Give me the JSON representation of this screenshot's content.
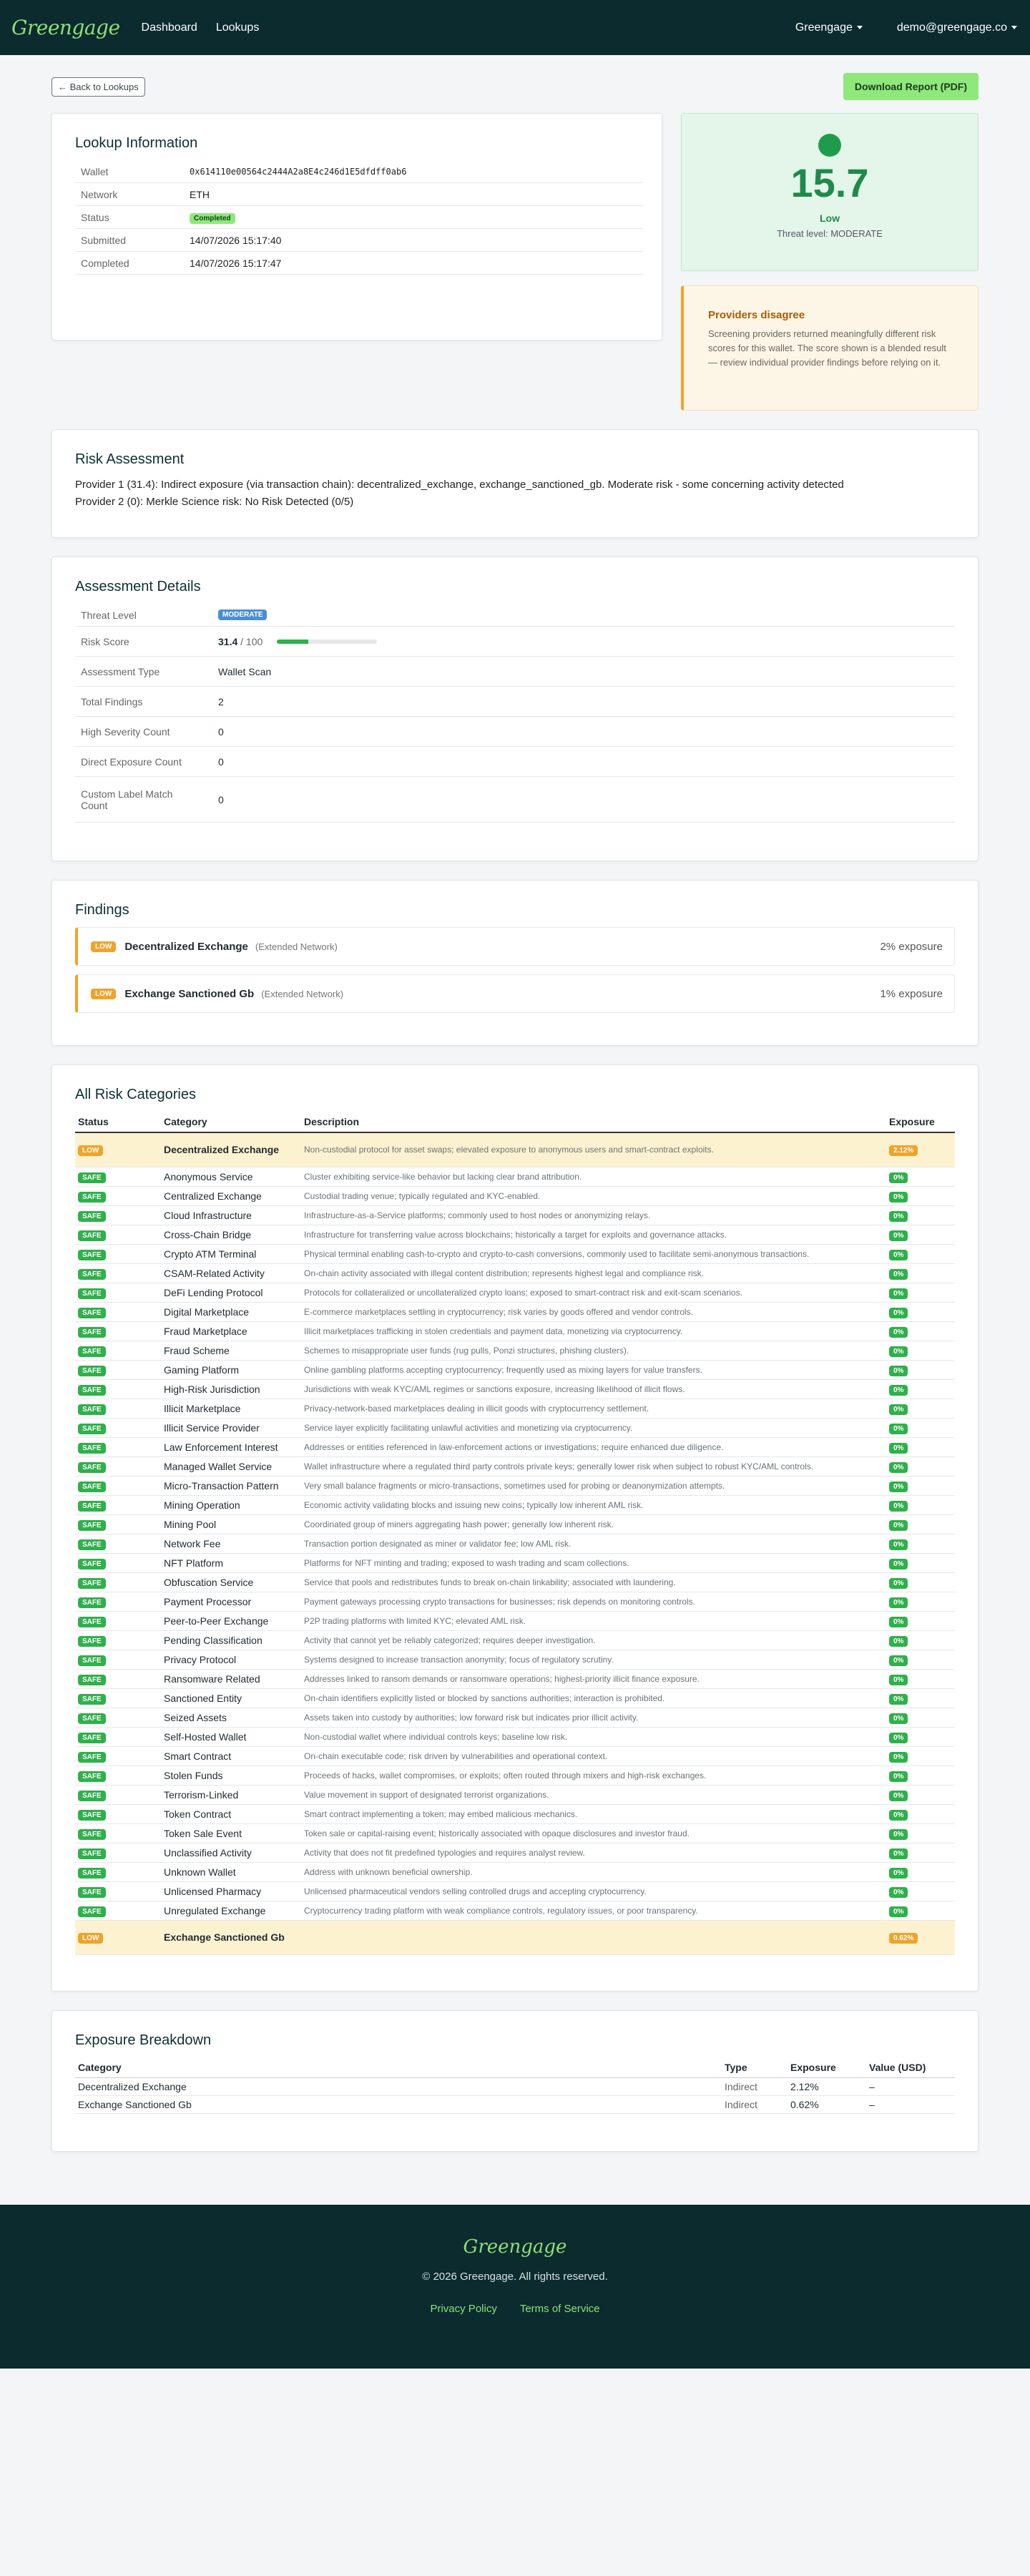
{
  "nav": {
    "brand": "Greengage",
    "links": [
      "Dashboard",
      "Lookups"
    ],
    "org": "Greengage",
    "user": "demo@greengage.co"
  },
  "actions": {
    "back": "← Back to Lookups",
    "download": "Download Report (PDF)"
  },
  "lookup": {
    "title": "Lookup Information",
    "rows": [
      {
        "k": "Wallet",
        "v": "0x614110e00564c2444A2a8E4c246d1E5dfdff0ab6"
      },
      {
        "k": "Network",
        "v": "ETH"
      },
      {
        "k": "Status",
        "v": "Completed"
      },
      {
        "k": "Submitted",
        "v": "14/07/2026 15:17:40"
      },
      {
        "k": "Completed",
        "v": "14/07/2026 15:17:47"
      }
    ]
  },
  "score": {
    "value": "15.7",
    "level": "Low",
    "sub": "Threat level: MODERATE",
    "color": "#1f9c4b"
  },
  "warning": {
    "title": "Providers disagree",
    "text": "Screening providers returned meaningfully different risk scores for this wallet. The score shown is a blended result — review individual provider findings before relying on it."
  },
  "risk": {
    "title": "Risk Assessment",
    "lines": [
      "Provider 1 (31.4): Indirect exposure (via transaction chain): decentralized_exchange, exchange_sanctioned_gb. Moderate risk - some concerning activity detected",
      "Provider 2 (0): Merkle Science risk: No Risk Detected (0/5)"
    ]
  },
  "details": {
    "title": "Assessment Details",
    "threat_label": "Threat Level",
    "threat": "MODERATE",
    "score_label": "Risk Score",
    "score": "31.4",
    "score_max": "/ 100",
    "score_fraction": 0.314,
    "rows": [
      {
        "k": "Assessment Type",
        "v": "Wallet Scan"
      },
      {
        "k": "Total Findings",
        "v": "2"
      },
      {
        "k": "High Severity Count",
        "v": "0"
      },
      {
        "k": "Direct Exposure Count",
        "v": "0"
      },
      {
        "k": "Custom Label Match Count",
        "v": "0"
      }
    ]
  },
  "findings": {
    "title": "Findings",
    "items": [
      {
        "badge": "LOW",
        "name": "Decentralized Exchange",
        "net": "(Extended Network)",
        "exp": "2% exposure"
      },
      {
        "badge": "LOW",
        "name": "Exchange Sanctioned Gb",
        "net": "(Extended Network)",
        "exp": "1% exposure"
      }
    ]
  },
  "categories": {
    "title": "All Risk Categories",
    "headers": [
      "Status",
      "Category",
      "Description",
      "Exposure"
    ],
    "rows": [
      {
        "s": "LOW",
        "c": "Decentralized Exchange",
        "d": "Non-custodial protocol for asset swaps; elevated exposure to anonymous users and smart-contract exploits.",
        "e": "2.12%"
      },
      {
        "s": "SAFE",
        "c": "Anonymous Service",
        "d": "Cluster exhibiting service-like behavior but lacking clear brand attribution.",
        "e": "0%"
      },
      {
        "s": "SAFE",
        "c": "Centralized Exchange",
        "d": "Custodial trading venue; typically regulated and KYC-enabled.",
        "e": "0%"
      },
      {
        "s": "SAFE",
        "c": "Cloud Infrastructure",
        "d": "Infrastructure-as-a-Service platforms; commonly used to host nodes or anonymizing relays.",
        "e": "0%"
      },
      {
        "s": "SAFE",
        "c": "Cross-Chain Bridge",
        "d": "Infrastructure for transferring value across blockchains; historically a target for exploits and governance attacks.",
        "e": "0%"
      },
      {
        "s": "SAFE",
        "c": "Crypto ATM Terminal",
        "d": "Physical terminal enabling cash-to-crypto and crypto-to-cash conversions, commonly used to facilitate semi-anonymous transactions.",
        "e": "0%"
      },
      {
        "s": "SAFE",
        "c": "CSAM-Related Activity",
        "d": "On-chain activity associated with illegal content distribution; represents highest legal and compliance risk.",
        "e": "0%"
      },
      {
        "s": "SAFE",
        "c": "DeFi Lending Protocol",
        "d": "Protocols for collateralized or uncollateralized crypto loans; exposed to smart-contract risk and exit-scam scenarios.",
        "e": "0%"
      },
      {
        "s": "SAFE",
        "c": "Digital Marketplace",
        "d": "E-commerce marketplaces settling in cryptocurrency; risk varies by goods offered and vendor controls.",
        "e": "0%"
      },
      {
        "s": "SAFE",
        "c": "Fraud Marketplace",
        "d": "Illicit marketplaces trafficking in stolen credentials and payment data, monetizing via cryptocurrency.",
        "e": "0%"
      },
      {
        "s": "SAFE",
        "c": "Fraud Scheme",
        "d": "Schemes to misappropriate user funds (rug pulls, Ponzi structures, phishing clusters).",
        "e": "0%"
      },
      {
        "s": "SAFE",
        "c": "Gaming Platform",
        "d": "Online gambling platforms accepting cryptocurrency; frequently used as mixing layers for value transfers.",
        "e": "0%"
      },
      {
        "s": "SAFE",
        "c": "High-Risk Jurisdiction",
        "d": "Jurisdictions with weak KYC/AML regimes or sanctions exposure, increasing likelihood of illicit flows.",
        "e": "0%"
      },
      {
        "s": "SAFE",
        "c": "Illicit Marketplace",
        "d": "Privacy-network-based marketplaces dealing in illicit goods with cryptocurrency settlement.",
        "e": "0%"
      },
      {
        "s": "SAFE",
        "c": "Illicit Service Provider",
        "d": "Service layer explicitly facilitating unlawful activities and monetizing via cryptocurrency.",
        "e": "0%"
      },
      {
        "s": "SAFE",
        "c": "Law Enforcement Interest",
        "d": "Addresses or entities referenced in law-enforcement actions or investigations; require enhanced due diligence.",
        "e": "0%"
      },
      {
        "s": "SAFE",
        "c": "Managed Wallet Service",
        "d": "Wallet infrastructure where a regulated third party controls private keys; generally lower risk when subject to robust KYC/AML controls.",
        "e": "0%"
      },
      {
        "s": "SAFE",
        "c": "Micro-Transaction Pattern",
        "d": "Very small balance fragments or micro-transactions, sometimes used for probing or deanonymization attempts.",
        "e": "0%"
      },
      {
        "s": "SAFE",
        "c": "Mining Operation",
        "d": "Economic activity validating blocks and issuing new coins; typically low inherent AML risk.",
        "e": "0%"
      },
      {
        "s": "SAFE",
        "c": "Mining Pool",
        "d": "Coordinated group of miners aggregating hash power; generally low inherent risk.",
        "e": "0%"
      },
      {
        "s": "SAFE",
        "c": "Network Fee",
        "d": "Transaction portion designated as miner or validator fee; low AML risk.",
        "e": "0%"
      },
      {
        "s": "SAFE",
        "c": "NFT Platform",
        "d": "Platforms for NFT minting and trading; exposed to wash trading and scam collections.",
        "e": "0%"
      },
      {
        "s": "SAFE",
        "c": "Obfuscation Service",
        "d": "Service that pools and redistributes funds to break on-chain linkability; associated with laundering.",
        "e": "0%"
      },
      {
        "s": "SAFE",
        "c": "Payment Processor",
        "d": "Payment gateways processing crypto transactions for businesses; risk depends on monitoring controls.",
        "e": "0%"
      },
      {
        "s": "SAFE",
        "c": "Peer-to-Peer Exchange",
        "d": "P2P trading platforms with limited KYC; elevated AML risk.",
        "e": "0%"
      },
      {
        "s": "SAFE",
        "c": "Pending Classification",
        "d": "Activity that cannot yet be reliably categorized; requires deeper investigation.",
        "e": "0%"
      },
      {
        "s": "SAFE",
        "c": "Privacy Protocol",
        "d": "Systems designed to increase transaction anonymity; focus of regulatory scrutiny.",
        "e": "0%"
      },
      {
        "s": "SAFE",
        "c": "Ransomware Related",
        "d": "Addresses linked to ransom demands or ransomware operations; highest-priority illicit finance exposure.",
        "e": "0%"
      },
      {
        "s": "SAFE",
        "c": "Sanctioned Entity",
        "d": "On-chain identifiers explicitly listed or blocked by sanctions authorities; interaction is prohibited.",
        "e": "0%"
      },
      {
        "s": "SAFE",
        "c": "Seized Assets",
        "d": "Assets taken into custody by authorities; low forward risk but indicates prior illicit activity.",
        "e": "0%"
      },
      {
        "s": "SAFE",
        "c": "Self-Hosted Wallet",
        "d": "Non-custodial wallet where individual controls keys; baseline low risk.",
        "e": "0%"
      },
      {
        "s": "SAFE",
        "c": "Smart Contract",
        "d": "On-chain executable code; risk driven by vulnerabilities and operational context.",
        "e": "0%"
      },
      {
        "s": "SAFE",
        "c": "Stolen Funds",
        "d": "Proceeds of hacks, wallet compromises, or exploits; often routed through mixers and high-risk exchanges.",
        "e": "0%"
      },
      {
        "s": "SAFE",
        "c": "Terrorism-Linked",
        "d": "Value movement in support of designated terrorist organizations.",
        "e": "0%"
      },
      {
        "s": "SAFE",
        "c": "Token Contract",
        "d": "Smart contract implementing a token; may embed malicious mechanics.",
        "e": "0%"
      },
      {
        "s": "SAFE",
        "c": "Token Sale Event",
        "d": "Token sale or capital-raising event; historically associated with opaque disclosures and investor fraud.",
        "e": "0%"
      },
      {
        "s": "SAFE",
        "c": "Unclassified Activity",
        "d": "Activity that does not fit predefined typologies and requires analyst review.",
        "e": "0%"
      },
      {
        "s": "SAFE",
        "c": "Unknown Wallet",
        "d": "Address with unknown beneficial ownership.",
        "e": "0%"
      },
      {
        "s": "SAFE",
        "c": "Unlicensed Pharmacy",
        "d": "Unlicensed pharmaceutical vendors selling controlled drugs and accepting cryptocurrency.",
        "e": "0%"
      },
      {
        "s": "SAFE",
        "c": "Unregulated Exchange",
        "d": "Cryptocurrency trading platform with weak compliance controls, regulatory issues, or poor transparency.",
        "e": "0%"
      },
      {
        "s": "LOW",
        "c": "Exchange Sanctioned Gb",
        "d": "",
        "e": "0.62%"
      }
    ]
  },
  "exposure": {
    "title": "Exposure Breakdown",
    "headers": [
      "Category",
      "Type",
      "Exposure",
      "Value (USD)"
    ],
    "rows": [
      {
        "c": "Decentralized Exchange",
        "t": "Indirect",
        "e": "2.12%",
        "v": "–"
      },
      {
        "c": "Exchange Sanctioned Gb",
        "t": "Indirect",
        "e": "0.62%",
        "v": "–"
      }
    ]
  },
  "footer": {
    "brand": "Greengage",
    "copy": "© 2026 Greengage. All rights reserved.",
    "links": [
      "Privacy Policy",
      "Terms of Service"
    ]
  }
}
